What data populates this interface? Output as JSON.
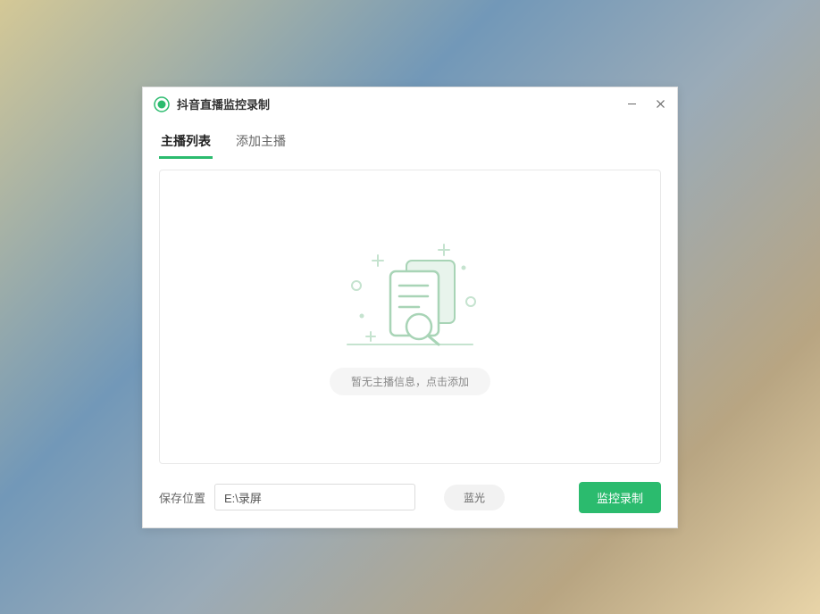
{
  "window": {
    "title": "抖音直播监控录制"
  },
  "tabs": {
    "list": "主播列表",
    "add": "添加主播"
  },
  "empty": {
    "message": "暂无主播信息，点击添加"
  },
  "footer": {
    "save_label": "保存位置",
    "save_path": "E:\\录屏",
    "quality": "蓝光",
    "record": "监控录制"
  }
}
